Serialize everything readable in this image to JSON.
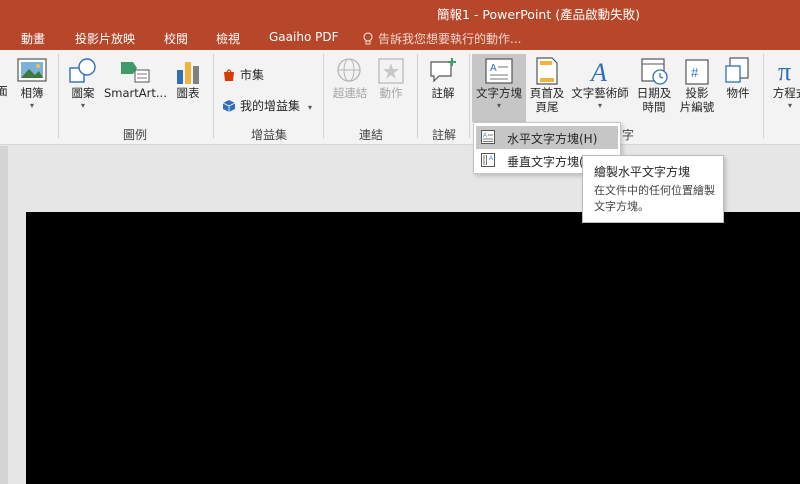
{
  "window": {
    "title": "簡報1 - PowerPoint (產品啟動失敗)"
  },
  "tabs": [
    {
      "label": "動畫"
    },
    {
      "label": "投影片放映"
    },
    {
      "label": "校閱"
    },
    {
      "label": "檢視"
    },
    {
      "label": "Gaaiho PDF"
    }
  ],
  "tell_me": {
    "placeholder": "告訴我您想要執行的動作..."
  },
  "ribbon": {
    "images": {
      "screenshot_label": "面",
      "album_label": "相簿",
      "group_label": "圖例",
      "shapes_label": "圖案",
      "smartart_label": "SmartArt...",
      "chart_label": "圖表"
    },
    "addins": {
      "store_label": "市集",
      "my_addins_label": "我的增益集",
      "group_label": "增益集"
    },
    "links": {
      "hyperlink_label": "超連結",
      "action_label": "動作",
      "group_label": "連結"
    },
    "comments": {
      "comment_label": "註解",
      "group_label": "註解"
    },
    "text": {
      "textbox_label": "文字方塊",
      "header_footer_label_1": "頁首及",
      "header_footer_label_2": "頁尾",
      "wordart_label": "文字藝術師",
      "datetime_label_1": "日期及",
      "datetime_label_2": "時間",
      "slide_number_label_1": "投影",
      "slide_number_label_2": "片編號",
      "object_label": "物件",
      "group_label_fragment": "字"
    },
    "symbols": {
      "equation_label": "方程式"
    },
    "accent_color": "#b7472a"
  },
  "dropdown": {
    "items": [
      {
        "label": "水平文字方塊(H)"
      },
      {
        "label": "垂直文字方塊("
      }
    ]
  },
  "tooltip": {
    "title": "繪製水平文字方塊",
    "body": "在文件中的任何位置繪製文字方塊。"
  }
}
